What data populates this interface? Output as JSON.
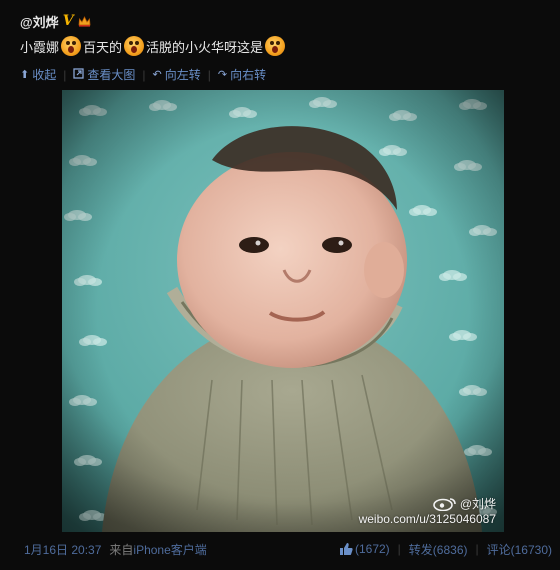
{
  "post": {
    "username": "@刘烨",
    "verified_badge": "V",
    "text_parts": [
      "小霞娜",
      "百天的",
      "活脱的小火华呀这是"
    ],
    "emoji_name": "surprised-face-emoji"
  },
  "toolbar": {
    "collapse": "收起",
    "view_large": "查看大图",
    "rotate_left": "向左转",
    "rotate_right": "向右转"
  },
  "photo": {
    "watermark_user": "@刘烨",
    "watermark_url": "weibo.com/u/3125046087"
  },
  "footer": {
    "time": "1月16日 20:37",
    "source_prefix": "来自",
    "source": "iPhone客户端",
    "likes": "(1672)",
    "repost": "转发(6836)",
    "comment": "评论(16730)"
  },
  "colors": {
    "background": "#0b0b0b",
    "link": "#6a8fc8",
    "badge": "#f5b400",
    "photo_background": "#6cb5b0"
  }
}
